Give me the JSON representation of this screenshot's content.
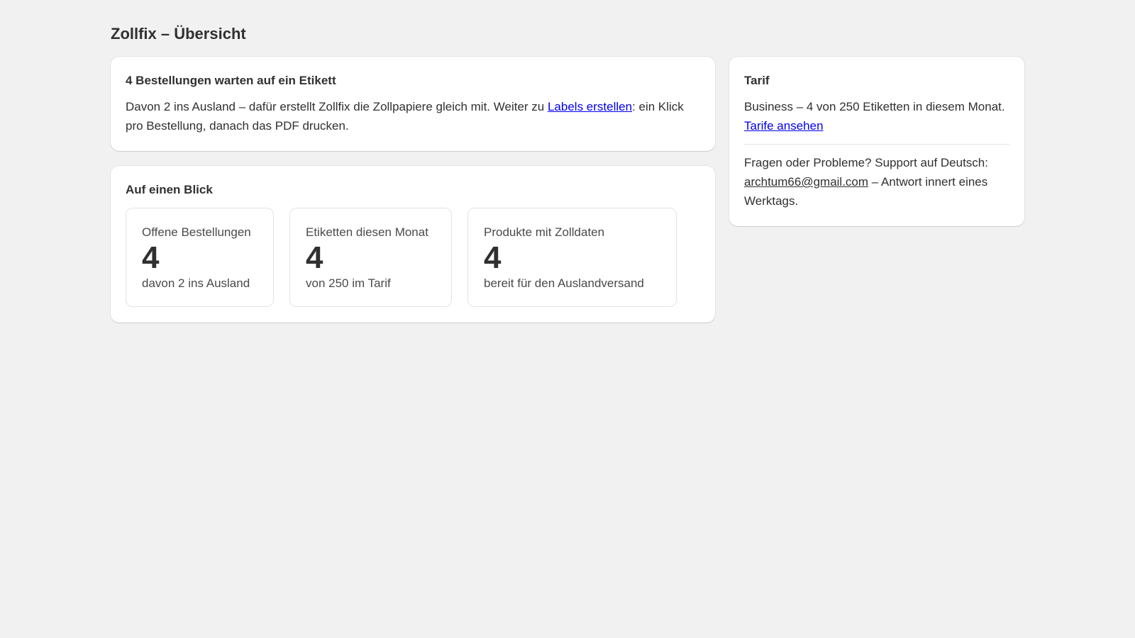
{
  "page": {
    "title": "Zollfix – Übersicht"
  },
  "alert_card": {
    "title": "4 Bestellungen warten auf ein Etikett",
    "text_before_link": "Davon 2 ins Ausland – dafür erstellt Zollfix die Zollpapiere gleich mit. Weiter zu ",
    "link_label": "Labels erstellen",
    "text_after_link": ": ein Klick pro Bestellung, danach das PDF drucken."
  },
  "overview_card": {
    "title": "Auf einen Blick",
    "metrics": [
      {
        "label": "Offene Bestellungen",
        "value": "4",
        "sub": "davon 2 ins Ausland"
      },
      {
        "label": "Etiketten diesen Monat",
        "value": "4",
        "sub": "von 250 im Tarif"
      },
      {
        "label": "Produkte mit Zolldaten",
        "value": "4",
        "sub": "bereit für den Auslandversand"
      }
    ]
  },
  "plan_card": {
    "title": "Tarif",
    "plan_text": "Business – 4 von 250 Etiketten in diesem Monat. ",
    "plan_link_label": "Tarife ansehen",
    "support_text_before": "Fragen oder Probleme? Support auf Deutsch: ",
    "support_email": "archtum66@gmail.com",
    "support_text_after": " – Antwort innert eines Werktags."
  },
  "colors": {
    "background": "#f1f1f1",
    "card": "#ffffff",
    "text": "#303030",
    "link": "#0000ee",
    "border": "#e3e3e3"
  }
}
